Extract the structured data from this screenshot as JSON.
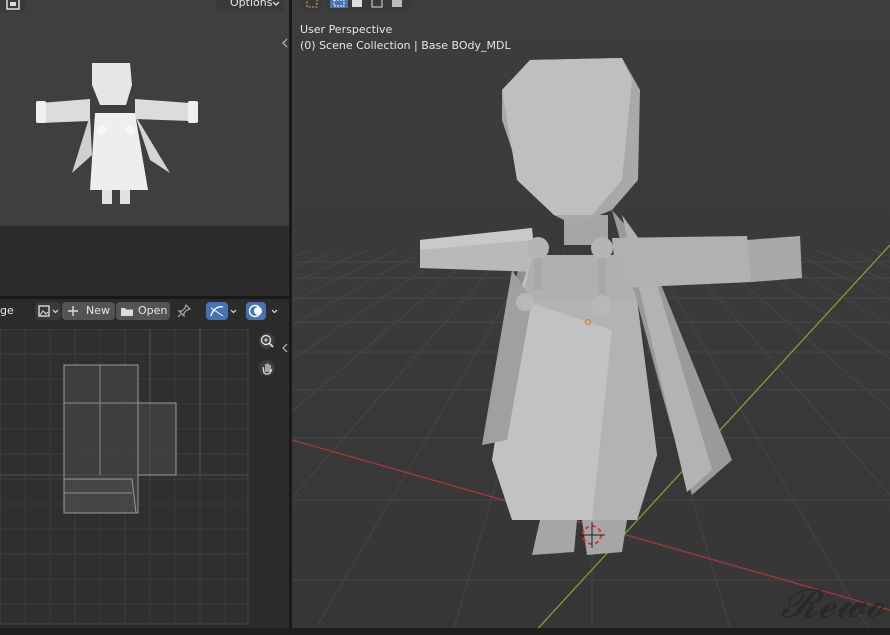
{
  "top_left": {
    "partial_icon": "image-icon",
    "options_label": "Options",
    "chevron": "chevron-down-icon"
  },
  "uv_editor": {
    "mode_partial": "ge",
    "image_icon": "image-icon",
    "new_label": "New",
    "open_label": "Open",
    "icons": [
      "plus-icon",
      "folder-icon",
      "pin-icon",
      "uv-sync-icon",
      "overlay-icon",
      "zoom-icon",
      "hand-icon"
    ]
  },
  "viewport": {
    "view_name": "User Perspective",
    "collection_info": "(0) Scene Collection | Base BOdy_MDL",
    "icons": [
      "select-box-icon",
      "select-mode-icons",
      "collapse-arrow-icon"
    ]
  },
  "colors": {
    "accent": "#4772b3",
    "x_axis": "#a33a3a",
    "y_axis": "#7ca03a",
    "panel_bg": "#2b2b2b",
    "viewport_bg": "#3b3b3b"
  },
  "watermark": "Rewo"
}
